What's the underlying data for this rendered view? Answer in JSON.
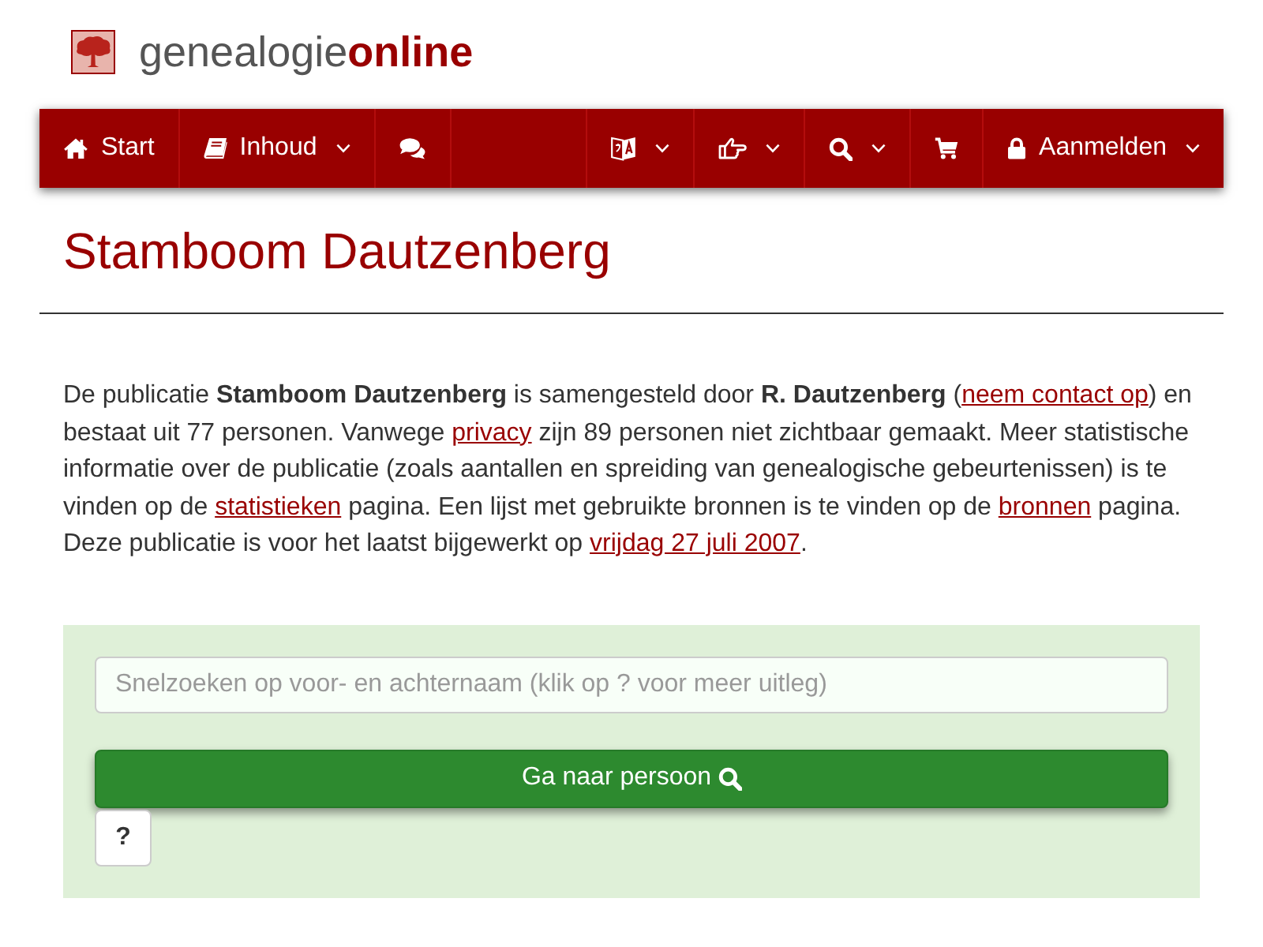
{
  "logo": {
    "text_regular": "genealogie",
    "text_bold": "online"
  },
  "nav": {
    "left": [
      {
        "label": "Start",
        "dropdown": false
      },
      {
        "label": "Inhoud",
        "dropdown": true
      },
      {
        "dropdown": false
      }
    ],
    "right": [
      {
        "dropdown": true
      },
      {
        "dropdown": true
      },
      {
        "dropdown": true
      },
      {
        "dropdown": false
      },
      {
        "label": "Aanmelden",
        "dropdown": true
      }
    ]
  },
  "title": "Stamboom Dautzenberg",
  "intro": [
    {
      "kind": "text",
      "text": "De publicatie **Stamboom Dautzenberg** is samengesteld door **R. Dautzenberg** ("
    },
    {
      "kind": "link",
      "text": "neem contact op"
    },
    {
      "kind": "text",
      "text": ") en bestaat uit 77 personen. Vanwege "
    },
    {
      "kind": "link",
      "text": "privacy"
    },
    {
      "kind": "text",
      "text": " zijn 89 personen niet zichtbaar gemaakt. Meer statistische informatie over de publicatie (zoals aantallen en spreiding van genealogische gebeurtenissen) is te vinden op de "
    },
    {
      "kind": "link",
      "text": "statistieken"
    },
    {
      "kind": "text",
      "text": " pagina. Een lijst met gebruikte bronnen is te vinden op de "
    },
    {
      "kind": "link",
      "text": "bronnen"
    },
    {
      "kind": "text",
      "text": " pagina. Deze publicatie is voor het laatst bijgewerkt op "
    },
    {
      "kind": "link",
      "text": "vrijdag 27 juli 2007"
    },
    {
      "kind": "text",
      "text": "."
    }
  ],
  "search": {
    "placeholder": "Snelzoeken op voor- en achternaam (klik op ? voor meer uitleg)",
    "submit_label": "Ga naar persoon",
    "help_label": "?"
  }
}
